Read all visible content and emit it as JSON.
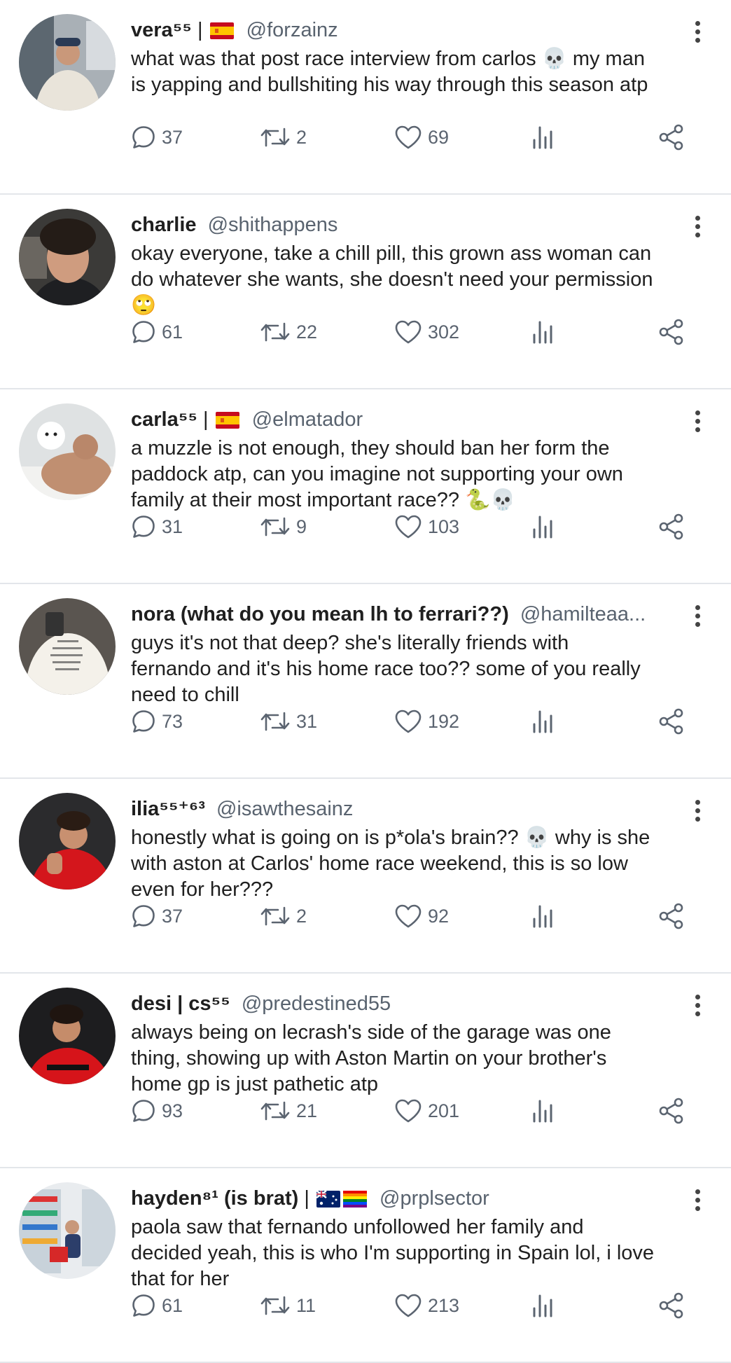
{
  "posts": [
    {
      "name": "vera⁵⁵",
      "sep": "|",
      "flags": [
        "spain-flag"
      ],
      "handle": "@forzainz",
      "text": "what was that post race interview from carlos 💀 my man\nis yapping and bullshiting his way through this season atp",
      "replies": "37",
      "reposts": "2",
      "likes": "69",
      "avatar": "avatar-man-white-sweater"
    },
    {
      "name": "charlie",
      "sep": "",
      "flags": [],
      "handle": "@shithappens",
      "text": "okay everyone, take a chill pill, this grown ass woman can\ndo whatever she wants, she doesn't need your permission\n🙄",
      "replies": "61",
      "reposts": "22",
      "likes": "302",
      "avatar": "avatar-man-curly-hair"
    },
    {
      "name": "carla⁵⁵",
      "sep": "|",
      "flags": [
        "spain-flag"
      ],
      "handle": "@elmatador",
      "text": "a muzzle is not enough, they should ban her form the\npaddock atp, can you imagine not supporting your own\nfamily at their most important race?? 🐍💀",
      "replies": "31",
      "reposts": "9",
      "likes": "103",
      "avatar": "avatar-man-with-dog"
    },
    {
      "name": "nora (what do you mean lh to ferrari??)",
      "sep": "",
      "flags": [],
      "handle": "@hamilteaa...",
      "text": "guys it's not that deep? she's literally friends with\nfernando and it's his home race too?? some of you really\nneed to chill",
      "replies": "73",
      "reposts": "31",
      "likes": "192",
      "avatar": "avatar-back-tshirt"
    },
    {
      "name": "ilia⁵⁵⁺⁶³",
      "sep": "",
      "flags": [],
      "handle": "@isawthesainz",
      "text": "honestly what is going on is p*ola's brain?? 💀 why is she\nwith aston at Carlos' home race weekend, this is so low\neven for her???",
      "replies": "37",
      "reposts": "2",
      "likes": "92",
      "avatar": "avatar-driver-red-suit"
    },
    {
      "name": "desi | cs⁵⁵",
      "sep": "",
      "flags": [],
      "handle": "@predestined55",
      "text": "always being on lecrash's side of the garage was one\nthing, showing up with Aston Martin on your brother's\nhome gp is just pathetic atp",
      "replies": "93",
      "reposts": "21",
      "likes": "201",
      "avatar": "avatar-driver-red-suit-2"
    },
    {
      "name": "hayden⁸¹ (is brat)",
      "sep": "|",
      "flags": [
        "australia-flag",
        "rainbow-flag"
      ],
      "handle": "@prplsector",
      "text": "paola saw that fernando unfollowed her family and\ndecided yeah, this is who I'm supporting in Spain lol, i love\nthat for her",
      "replies": "61",
      "reposts": "11",
      "likes": "213",
      "avatar": "avatar-supermarket-cart"
    }
  ],
  "colors": {
    "text": "#202020",
    "muted": "#5b6470",
    "divider": "#e3e6ea"
  }
}
